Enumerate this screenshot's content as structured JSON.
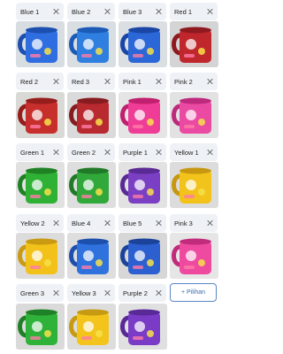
{
  "variants": [
    {
      "label": "Blue 1",
      "cup": "#2f6ee0",
      "shade": "#1c4fb0",
      "bg": "#d8dde2"
    },
    {
      "label": "Blue 2",
      "cup": "#2e7fe0",
      "shade": "#1b5bb7",
      "bg": "#d9dee3"
    },
    {
      "label": "Blue 3",
      "cup": "#2c67d8",
      "shade": "#1a47a6",
      "bg": "#dcdfe2"
    },
    {
      "label": "Red 1",
      "cup": "#c0272d",
      "shade": "#8e1a1f",
      "bg": "#d4d4d4"
    },
    {
      "label": "Red 2",
      "cup": "#c62f2b",
      "shade": "#951d1c",
      "bg": "#d9d9d6"
    },
    {
      "label": "Red 3",
      "cup": "#b82a2f",
      "shade": "#861b20",
      "bg": "#dadada"
    },
    {
      "label": "Pink 1",
      "cup": "#ef3c97",
      "shade": "#c0206f",
      "bg": "#e5e5e5"
    },
    {
      "label": "Pink 2",
      "cup": "#ea4aa2",
      "shade": "#bd2a7d",
      "bg": "#e2e2e2"
    },
    {
      "label": "Green 1",
      "cup": "#2fb135",
      "shade": "#1f8124",
      "bg": "#e1e1e1"
    },
    {
      "label": "Green 2",
      "cup": "#31a83a",
      "shade": "#207a27",
      "bg": "#dedede"
    },
    {
      "label": "Purple 1",
      "cup": "#7b3fc4",
      "shade": "#5a2a95",
      "bg": "#e2e2e2"
    },
    {
      "label": "Yellow 1",
      "cup": "#f2c31b",
      "shade": "#c79710",
      "bg": "#dcdcdc"
    },
    {
      "label": "Yellow 2",
      "cup": "#f2c21a",
      "shade": "#c99a12",
      "bg": "#dcdcdc"
    },
    {
      "label": "Blue 4",
      "cup": "#2f72de",
      "shade": "#1d50ad",
      "bg": "#dedede"
    },
    {
      "label": "Blue 5",
      "cup": "#2c5fd0",
      "shade": "#1b4399",
      "bg": "#d7d7d7"
    },
    {
      "label": "Pink 3",
      "cup": "#ee4aa0",
      "shade": "#c12b7b",
      "bg": "#e6e6e6"
    },
    {
      "label": "Green 3",
      "cup": "#2fb23a",
      "shade": "#1f8127",
      "bg": "#dadada"
    },
    {
      "label": "Yellow 3",
      "cup": "#f3c51c",
      "shade": "#c69a12",
      "bg": "#dddddd"
    },
    {
      "label": "Purple 2",
      "cup": "#7a3cc6",
      "shade": "#582997",
      "bg": "#e0e0e0"
    }
  ],
  "add_option": {
    "label": "+ Pilihan"
  },
  "icons": {
    "remove": "close-icon"
  }
}
